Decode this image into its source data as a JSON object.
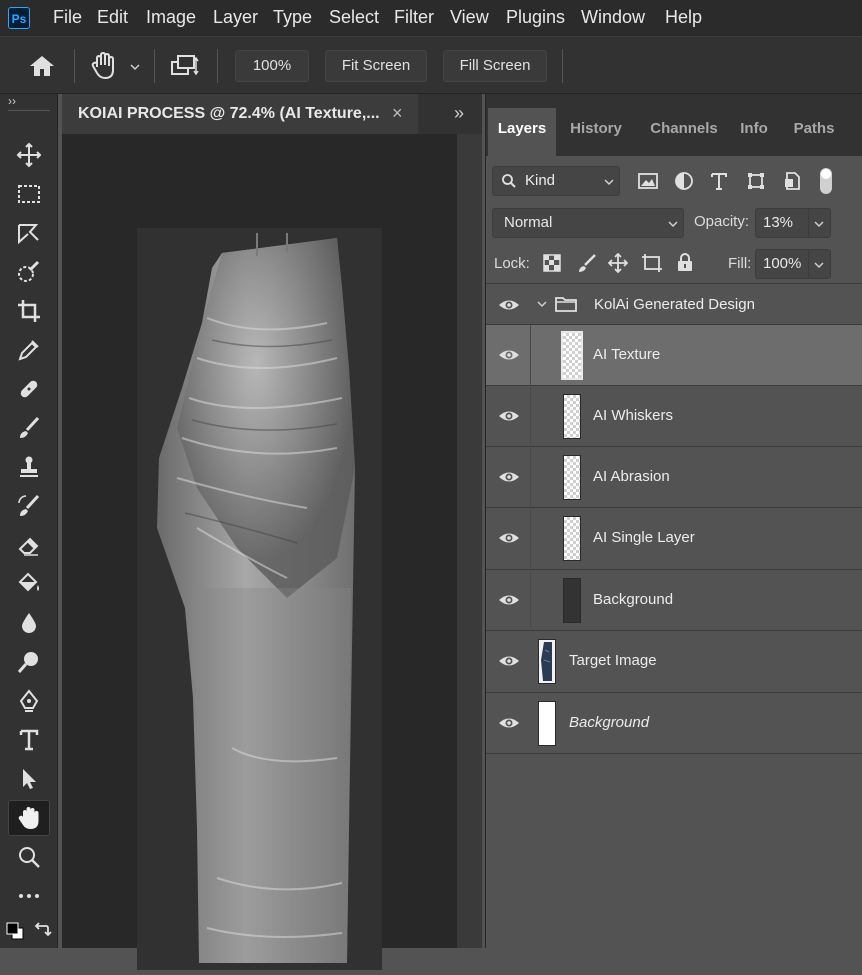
{
  "menubar": {
    "logo": "Ps",
    "items": [
      "File",
      "Edit",
      "Image",
      "Layer",
      "Type",
      "Select",
      "Filter",
      "View",
      "Plugins",
      "Window",
      "Help"
    ]
  },
  "options": {
    "zoom_label": "100%",
    "fit_screen_label": "Fit Screen",
    "fill_screen_label": "Fill Screen"
  },
  "toolbar": {
    "collapse_label": "››",
    "tools": [
      "move-tool",
      "marquee-tool",
      "lasso-tool",
      "quick-selection-tool",
      "crop-tool",
      "eyedropper-tool",
      "healing-brush-tool",
      "brush-tool",
      "clone-stamp-tool",
      "history-brush-tool",
      "eraser-tool",
      "paint-bucket-tool",
      "blur-tool",
      "dodge-tool",
      "pen-tool",
      "type-tool",
      "path-selection-tool",
      "hand-tool",
      "zoom-tool",
      "more-tools"
    ],
    "active_tool": "hand-tool"
  },
  "document": {
    "tab_title": "KOIAI PROCESS @ 72.4% (AI Texture,...",
    "close_glyph": "×",
    "expand_glyph": "»"
  },
  "panel": {
    "tabs": [
      "Layers",
      "History",
      "Channels",
      "Info",
      "Paths"
    ],
    "active_tab": "Layers",
    "filter_kind": "Kind",
    "blend_mode": "Normal",
    "opacity_label": "Opacity:",
    "opacity_value": "13%",
    "lock_label": "Lock:",
    "fill_label": "Fill:",
    "fill_value": "100%",
    "layers": [
      {
        "name": "KolAi Generated Design",
        "type": "group",
        "visible": true
      },
      {
        "name": "AI Texture",
        "type": "layer",
        "visible": true,
        "selected": true,
        "thumb": "transparent"
      },
      {
        "name": "AI Whiskers",
        "type": "layer",
        "visible": true,
        "thumb": "transparent"
      },
      {
        "name": "AI Abrasion",
        "type": "layer",
        "visible": true,
        "thumb": "transparent"
      },
      {
        "name": "AI Single Layer",
        "type": "layer",
        "visible": true,
        "thumb": "transparent"
      },
      {
        "name": "Background",
        "type": "layer",
        "visible": true,
        "thumb": "dark"
      },
      {
        "name": "Target Image",
        "type": "layer",
        "visible": true,
        "thumb": "jeans"
      },
      {
        "name": "Background",
        "type": "background",
        "visible": true,
        "thumb": "white",
        "italic": true
      }
    ]
  },
  "colors": {
    "menubar_bg": "#2b2b2b",
    "panel_bg": "#535353",
    "selected_layer_bg": "#6d6d6d",
    "ps_accent": "#31a8ff"
  }
}
